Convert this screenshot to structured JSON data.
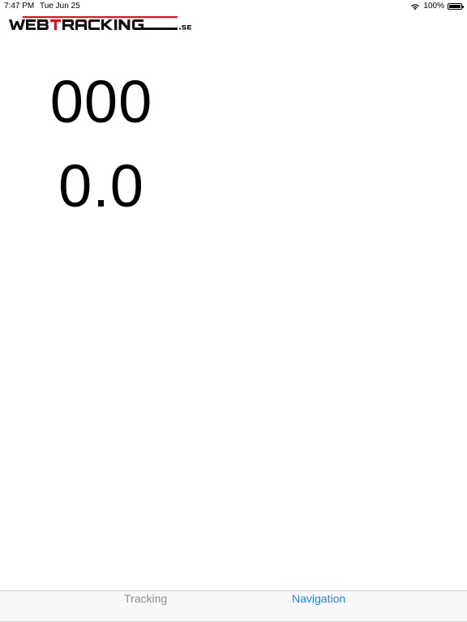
{
  "status_bar": {
    "time": "7:47 PM",
    "date": "Tue Jun 25",
    "battery_percent": "100%",
    "battery_level": 1.0,
    "icons": [
      "wifi-icon",
      "battery-icon"
    ]
  },
  "header": {
    "logo_text": "WEBTRACKING.se",
    "brand_colors": {
      "text": "#111111",
      "accent": "#e5131b"
    }
  },
  "readouts": {
    "primary_value": "000",
    "secondary_value": "0.0"
  },
  "tab_bar": {
    "tabs": [
      {
        "label": "Tracking",
        "selected": false,
        "color": "#8e8e93"
      },
      {
        "label": "Navigation",
        "selected": true,
        "color": "#1a82f0"
      }
    ]
  }
}
